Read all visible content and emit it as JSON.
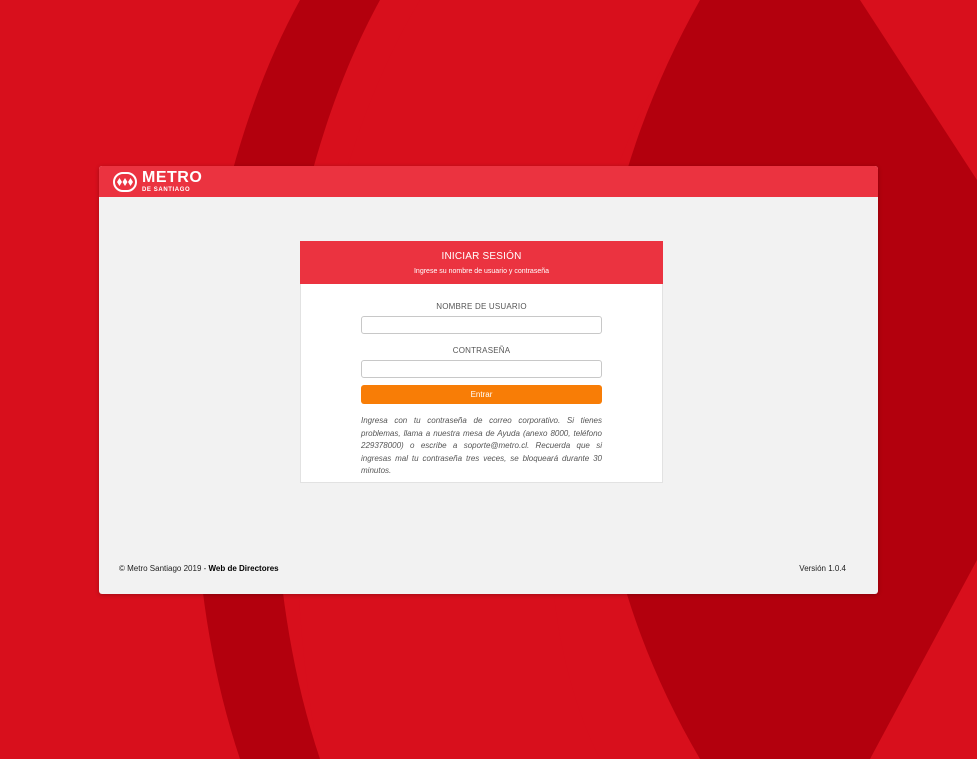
{
  "colors": {
    "background": "#d80f1c",
    "background_dark": "#b3000d",
    "brand_red": "#eb3340",
    "button_orange": "#f87d06"
  },
  "header": {
    "logo": {
      "icon": "metro-logo-icon",
      "main_text": "METRO",
      "sub_text": "DE SANTIAGO"
    }
  },
  "login": {
    "title": "INICIAR SESIÓN",
    "subtitle": "Ingrese su nombre de usuario y contraseña",
    "username_label": "NOMBRE DE USUARIO",
    "username_value": "",
    "password_label": "CONTRASEÑA",
    "password_value": "",
    "submit_label": "Entrar",
    "help_text": "Ingresa con tu contraseña de correo corporativo. Si tienes problemas, llama a nuestra mesa de Ayuda (anexo 8000, teléfono 229378000) o escribe a soporte@metro.cl. Recuerda que si ingresas mal tu contraseña tres veces, se bloqueará durante 30 minutos."
  },
  "footer": {
    "copyright": "© Metro Santiago 2019 - ",
    "app_name": "Web de Directores",
    "version": "Versión 1.0.4"
  }
}
